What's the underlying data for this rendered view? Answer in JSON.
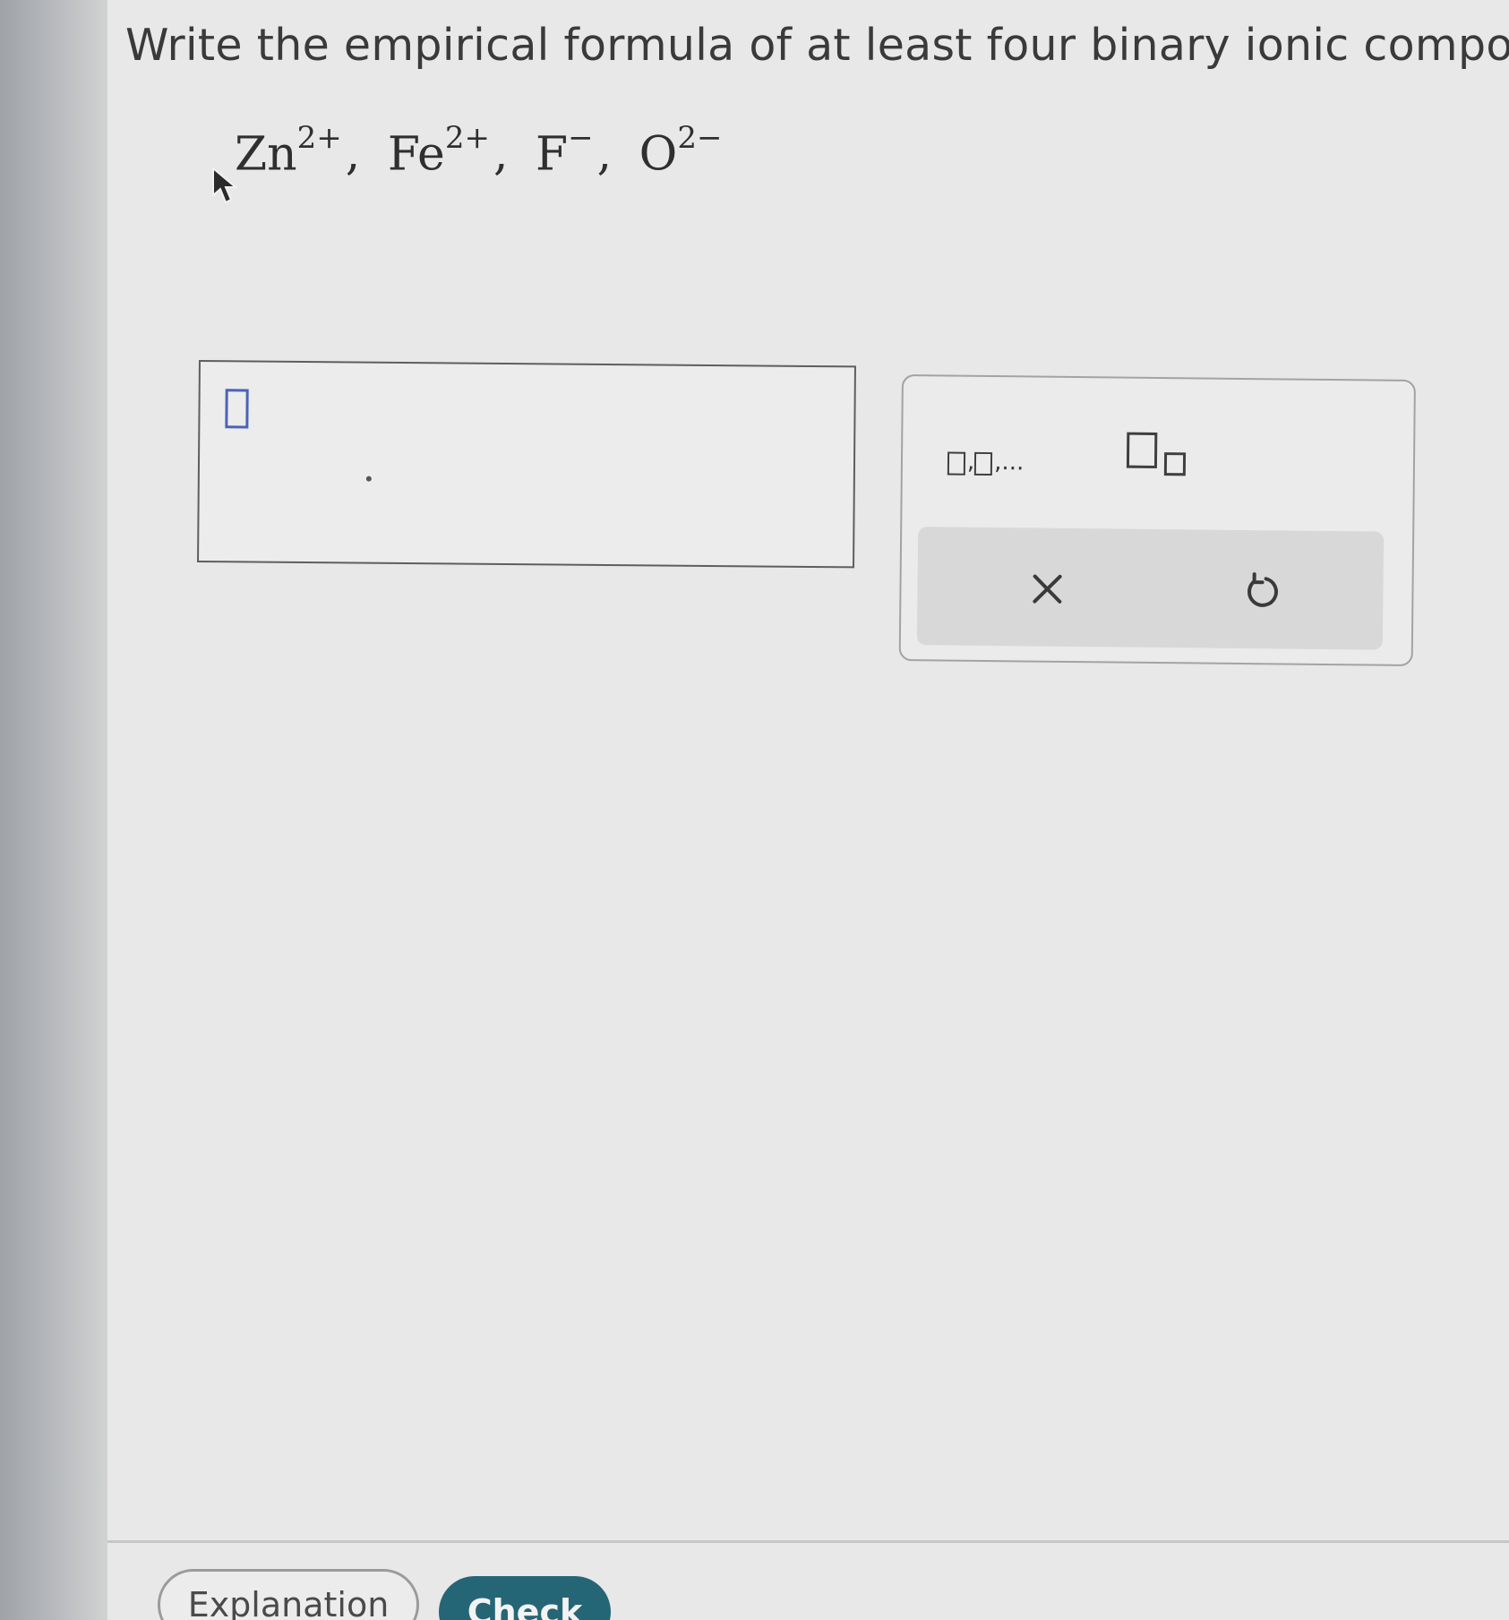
{
  "question": {
    "text": "Write the empirical formula of at least four binary ionic compounds tha"
  },
  "ions": [
    {
      "symbol": "Zn",
      "charge": "2+"
    },
    {
      "symbol": "Fe",
      "charge": "2+"
    },
    {
      "symbol": "F",
      "charge": "−"
    },
    {
      "symbol": "O",
      "charge": "2−"
    }
  ],
  "separator": ",",
  "toolbar": {
    "comma_list_label": ",",
    "comma_list_ellipsis": ",...",
    "clear_glyph": "×",
    "undo_glyph": "↺"
  },
  "icons": {
    "cursor": "mouse-pointer-icon",
    "clear": "close-icon",
    "undo": "undo-icon"
  },
  "colors": {
    "answer_slot": "#4b63b8",
    "check_button": "#256676"
  },
  "footer": {
    "explanation_label": "Explanation",
    "check_label": "Check"
  }
}
